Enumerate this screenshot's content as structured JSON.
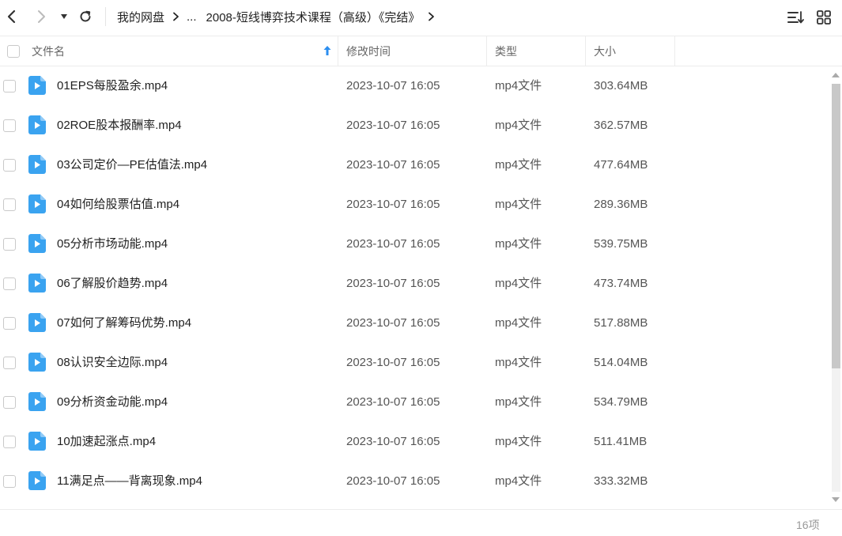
{
  "toolbar": {
    "back_icon": "chevron-left-icon",
    "forward_icon": "chevron-right-icon",
    "history_icon": "caret-down-icon",
    "refresh_icon": "refresh-icon",
    "sort_icon": "sort-list-icon",
    "grid_icon": "grid-view-icon"
  },
  "breadcrumb": {
    "root": "我的网盘",
    "ellipsis": "...",
    "current": "2008-短线博弈技术课程（高级）《完结》"
  },
  "columns": {
    "name": "文件名",
    "modified": "修改时间",
    "type": "类型",
    "size": "大小"
  },
  "files": [
    {
      "name": "01EPS每股盈余.mp4",
      "modified": "2023-10-07 16:05",
      "type": "mp4文件",
      "size": "303.64MB"
    },
    {
      "name": "02ROE股本报酬率.mp4",
      "modified": "2023-10-07 16:05",
      "type": "mp4文件",
      "size": "362.57MB"
    },
    {
      "name": "03公司定价—PE估值法.mp4",
      "modified": "2023-10-07 16:05",
      "type": "mp4文件",
      "size": "477.64MB"
    },
    {
      "name": "04如何给股票估值.mp4",
      "modified": "2023-10-07 16:05",
      "type": "mp4文件",
      "size": "289.36MB"
    },
    {
      "name": "05分析市场动能.mp4",
      "modified": "2023-10-07 16:05",
      "type": "mp4文件",
      "size": "539.75MB"
    },
    {
      "name": "06了解股价趋势.mp4",
      "modified": "2023-10-07 16:05",
      "type": "mp4文件",
      "size": "473.74MB"
    },
    {
      "name": "07如何了解筹码优势.mp4",
      "modified": "2023-10-07 16:05",
      "type": "mp4文件",
      "size": "517.88MB"
    },
    {
      "name": "08认识安全边际.mp4",
      "modified": "2023-10-07 16:05",
      "type": "mp4文件",
      "size": "514.04MB"
    },
    {
      "name": "09分析资金动能.mp4",
      "modified": "2023-10-07 16:05",
      "type": "mp4文件",
      "size": "534.79MB"
    },
    {
      "name": "10加速起涨点.mp4",
      "modified": "2023-10-07 16:05",
      "type": "mp4文件",
      "size": "511.41MB"
    },
    {
      "name": "11满足点——背离现象.mp4",
      "modified": "2023-10-07 16:05",
      "type": "mp4文件",
      "size": "333.32MB"
    }
  ],
  "footer": {
    "count": "16项"
  },
  "colors": {
    "file_icon": "#3aa3f0",
    "sort_arrow": "#2b8ef0"
  }
}
